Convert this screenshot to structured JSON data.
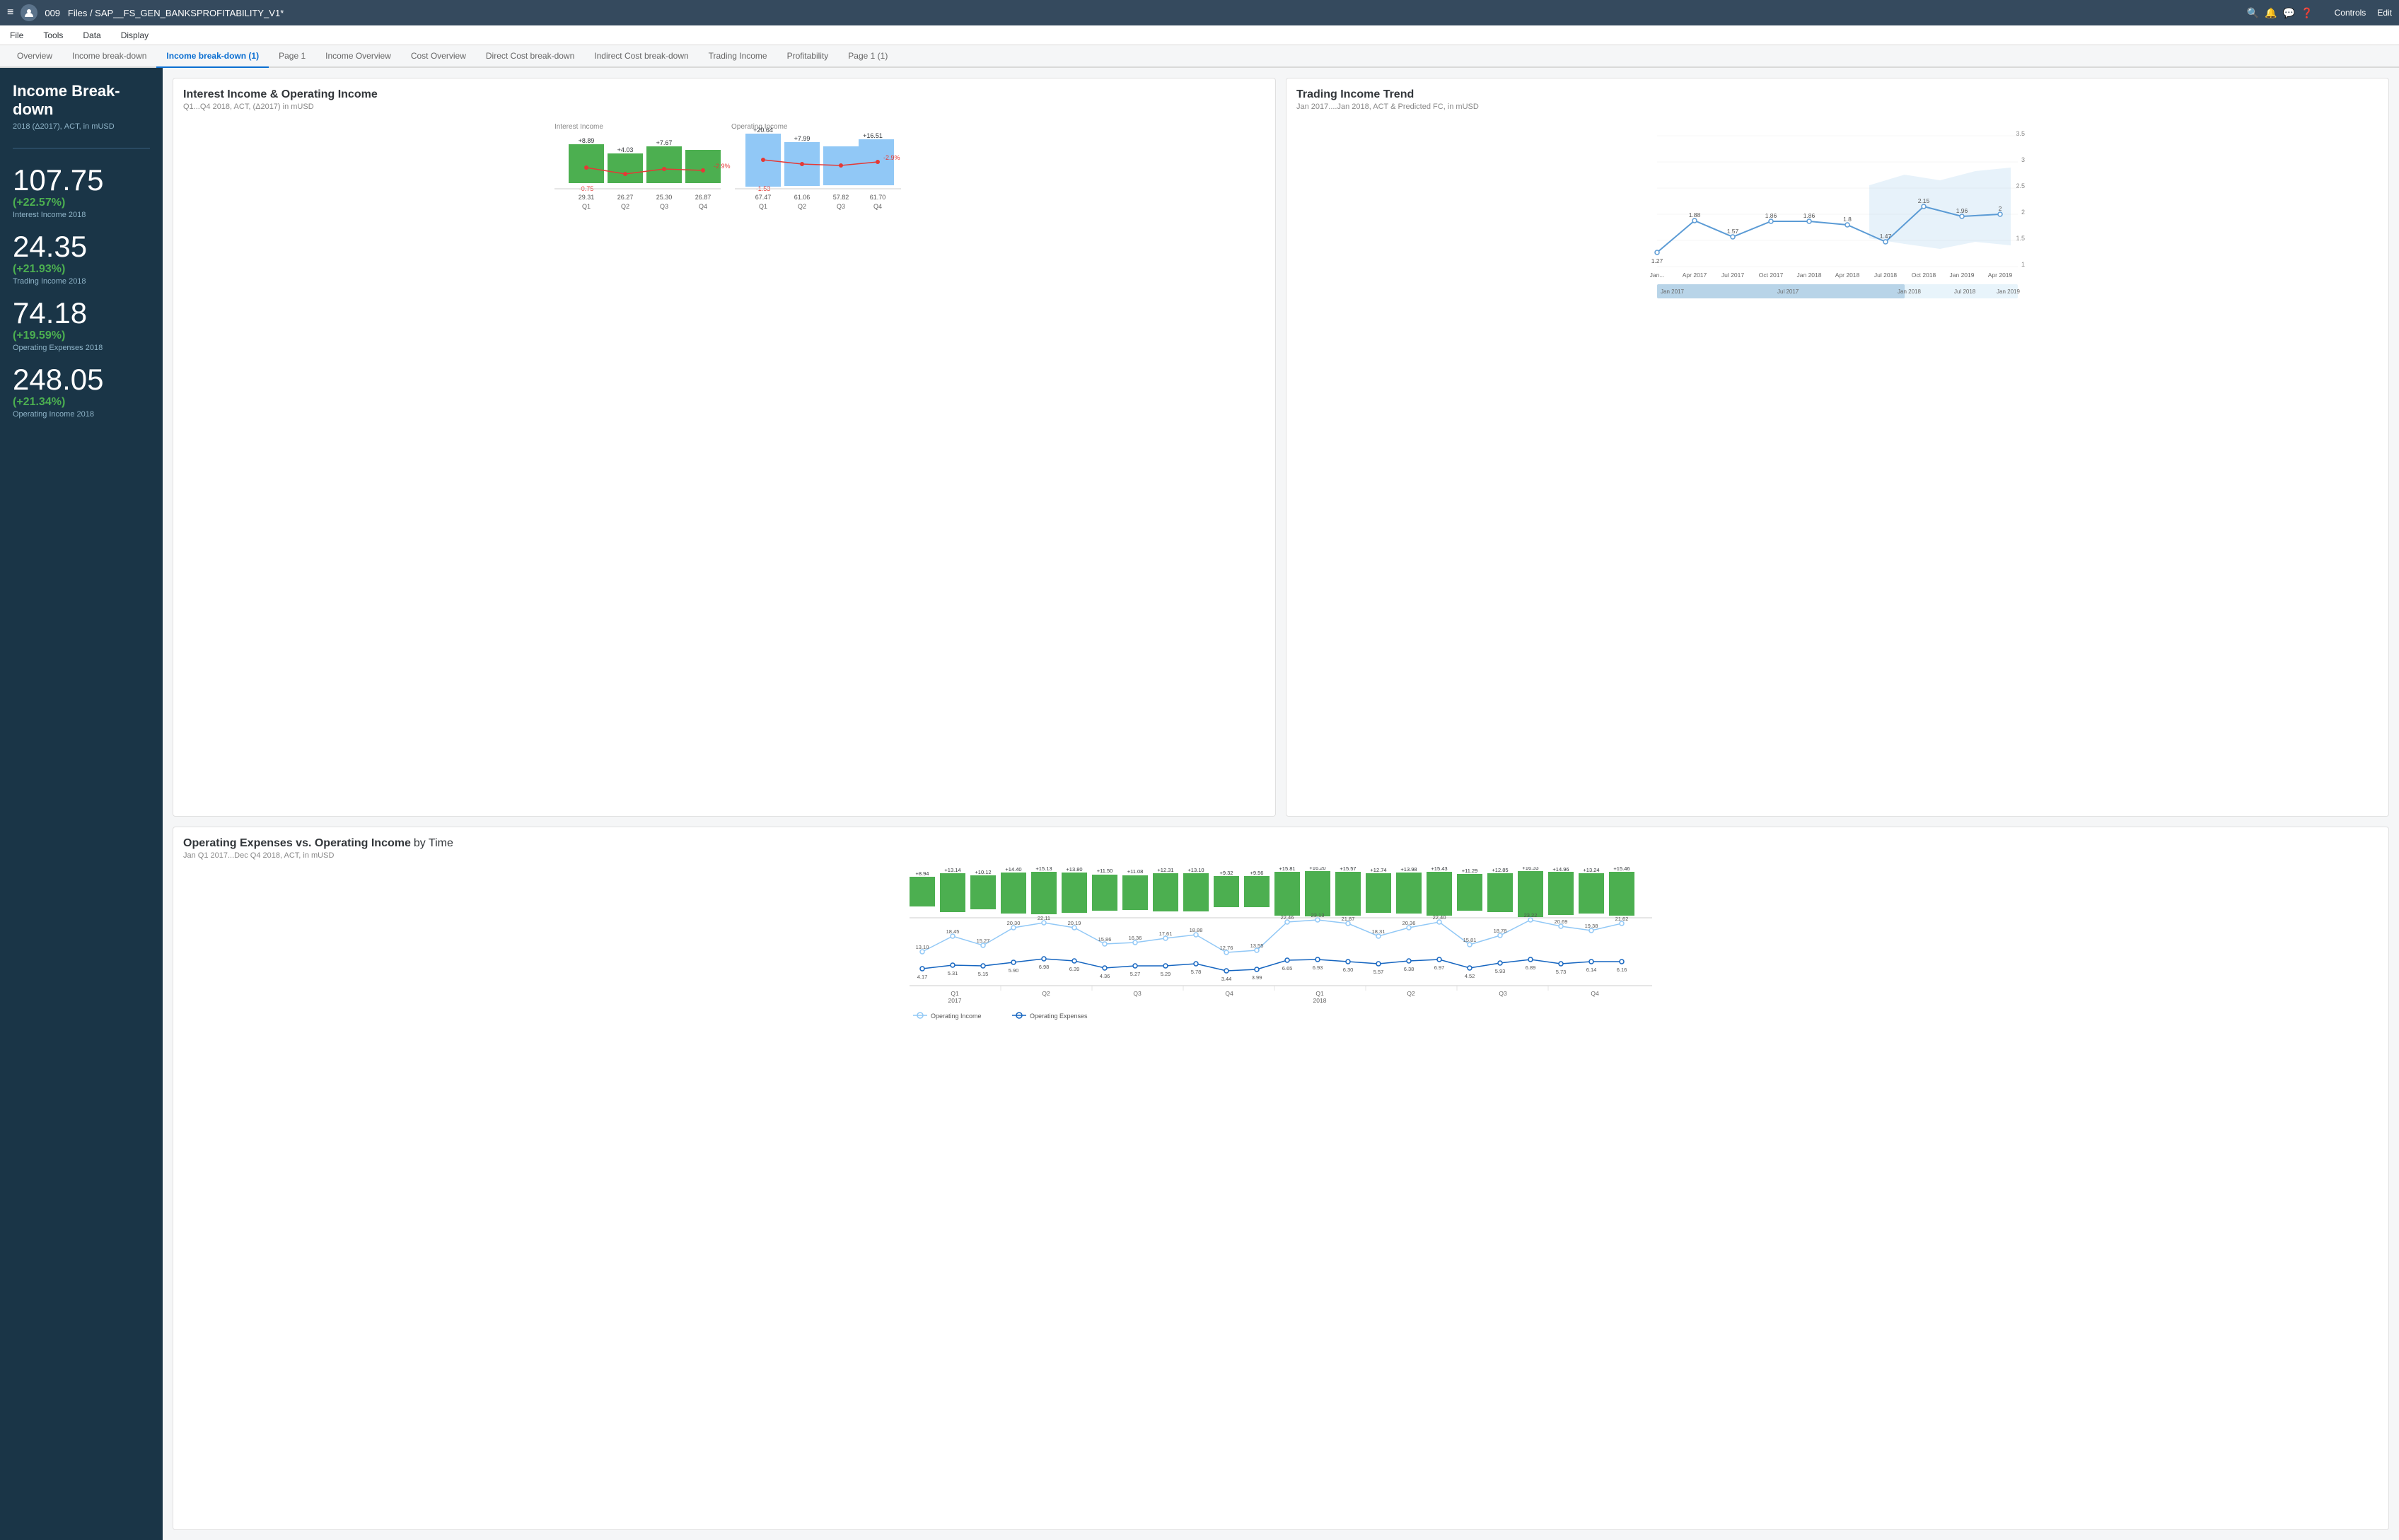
{
  "topbar": {
    "menu_icon": "≡",
    "app_id": "009",
    "breadcrumb": "Files / SAP__FS_GEN_BANKSPROFITABILITY_V1*",
    "controls_label": "Controls",
    "edit_label": "Edit"
  },
  "menubar": {
    "items": [
      "File",
      "Tools",
      "Data",
      "Display"
    ]
  },
  "tabs": [
    {
      "label": "Overview",
      "active": false
    },
    {
      "label": "Income break-down",
      "active": false
    },
    {
      "label": "Income break-down (1)",
      "active": true
    },
    {
      "label": "Page 1",
      "active": false
    },
    {
      "label": "Income Overview",
      "active": false
    },
    {
      "label": "Cost Overview",
      "active": false
    },
    {
      "label": "Direct Cost break-down",
      "active": false
    },
    {
      "label": "Indirect Cost break-down",
      "active": false
    },
    {
      "label": "Trading Income",
      "active": false
    },
    {
      "label": "Profitability",
      "active": false
    },
    {
      "label": "Page 1 (1)",
      "active": false
    }
  ],
  "sidebar": {
    "title": "Income Break-down",
    "subtitle": "2018 (Δ2017), ACT, in mUSD",
    "metrics": [
      {
        "value": "107.75",
        "pct": "(+22.57%)",
        "label": "Interest Income 2018"
      },
      {
        "value": "24.35",
        "pct": "(+21.93%)",
        "label": "Trading Income 2018"
      },
      {
        "value": "74.18",
        "pct": "(+19.59%)",
        "label": "Operating Expenses 2018"
      },
      {
        "value": "248.05",
        "pct": "(+21.34%)",
        "label": "Operating Income 2018"
      }
    ]
  },
  "interest_income": {
    "title": "Interest Income & Operating Income",
    "subtitle": "Q1...Q4 2018, ACT, (Δ2017) in mUSD",
    "interest_label": "Interest Income",
    "operating_label": "Operating Income",
    "interest_bars": [
      {
        "q": "Q1",
        "top": "+8.89",
        "bottom": "-0.75",
        "height_green": 65,
        "height_blue": 0
      },
      {
        "q": "Q2",
        "top": "+4.03",
        "bottom": "",
        "height_green": 40,
        "height_blue": 0
      },
      {
        "q": "Q3",
        "top": "+7.67",
        "bottom": "",
        "height_green": 55,
        "height_blue": 0
      },
      {
        "q": "Q4",
        "top": "",
        "bottom": "",
        "height_green": 50,
        "height_blue": 0
      }
    ],
    "interest_values": [
      "29.31",
      "26.27",
      "25.30",
      "26.87"
    ],
    "operating_bars": [
      {
        "q": "Q1",
        "top": "+20.64",
        "height": 90
      },
      {
        "q": "Q2",
        "top": "+7.99",
        "height": 72
      },
      {
        "q": "Q3",
        "top": "",
        "height": 68
      },
      {
        "q": "Q4",
        "top": "+16.51",
        "height": 80
      }
    ],
    "operating_top_labels": [
      "+20.64",
      "+7.99",
      "",
      "+16.51"
    ],
    "operating_bottom_labels": [
      "-1.53",
      "",
      "",
      ""
    ],
    "operating_values": [
      "67.47",
      "61.06",
      "57.82",
      "61.70"
    ],
    "trend_label": "-2.9%"
  },
  "trading_trend": {
    "title": "Trading Income Trend",
    "subtitle": "Jan 2017....Jan 2018, ACT & Predicted FC, in mUSD",
    "y_labels": [
      "3.5",
      "3",
      "2.5",
      "2",
      "1.5",
      "1"
    ],
    "x_labels": [
      "Jan...",
      "Apr 2017",
      "Jul 2017",
      "Oct 2017",
      "Jan 2018",
      "Apr 2018",
      "Jul 2018",
      "Oct 2018",
      "Jan 2019",
      "Apr 2019"
    ],
    "data_points": [
      "1.27",
      "1.88",
      "1.57",
      "1.86",
      "1.86",
      "1.8",
      "1.47",
      "2.15",
      "1.96",
      "2"
    ]
  },
  "operating_expenses": {
    "title": "Operating Expenses vs. Operating Income",
    "title_suffix": " by Time",
    "subtitle": "Jan Q1 2017...Dec Q4 2018, ACT, in mUSD",
    "bar_values": [
      "+8.94",
      "+13.14",
      "+10.12",
      "+14.40",
      "+15.13",
      "+13.80",
      "+11.50",
      "+11.08",
      "+12.31",
      "+13.10",
      "+9.32",
      "+9.56",
      "+15.81",
      "+16.20",
      "+15.57",
      "+12.74",
      "+13.98",
      "+15.43",
      "+11.29",
      "+12.85",
      "+16.33",
      "+14.96",
      "+13.24",
      "+15.46"
    ],
    "bar_heights": [
      42,
      58,
      48,
      62,
      64,
      60,
      52,
      50,
      55,
      58,
      44,
      46,
      66,
      68,
      65,
      56,
      60,
      64,
      52,
      56,
      68,
      63,
      58,
      65
    ],
    "line1_values": [
      "13.10",
      "18.45",
      "15.27",
      "20.30",
      "22.11",
      "20.19",
      "15.86",
      "16.36",
      "17.61",
      "18.88",
      "12.76",
      "13.55",
      "22.46",
      "23.13",
      "21.87",
      "18.31",
      "20.36",
      "22.40",
      "15.81",
      "18.78",
      "23.22",
      "20.69",
      "19.38",
      "21.62"
    ],
    "line2_values": [
      "4.17",
      "5.31",
      "5.15",
      "5.90",
      "6.98",
      "6.39",
      "4.36",
      "5.27",
      "5.29",
      "5.78",
      "3.44",
      "3.99",
      "6.65",
      "6.93",
      "6.30",
      "5.57",
      "6.38",
      "6.97",
      "4.52",
      "5.93",
      "6.89",
      "5.73",
      "6.14",
      "6.16"
    ],
    "q_labels": [
      "Q1\n2017",
      "Q2",
      "Q3",
      "Q4",
      "Q1\n2018",
      "Q2",
      "Q3",
      "Q4"
    ],
    "legend": {
      "item1": "Operating Income",
      "item2": "Operating Expenses"
    }
  }
}
